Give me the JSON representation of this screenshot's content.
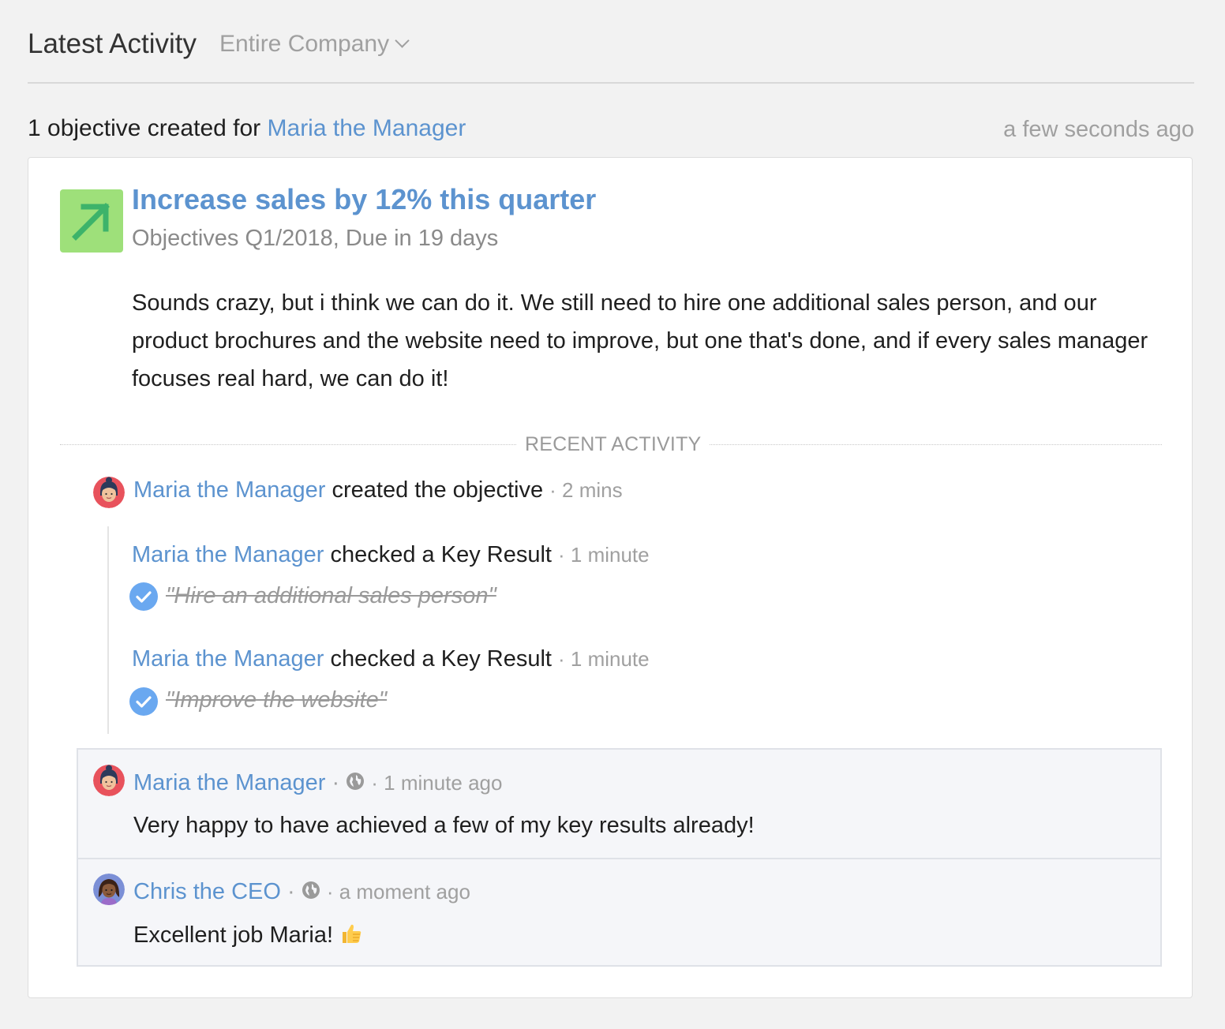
{
  "header": {
    "title": "Latest Activity",
    "scope_label": "Entire Company"
  },
  "activity": {
    "summary_prefix": "1 objective created for",
    "summary_user": "Maria the Manager",
    "timestamp": "a few seconds ago"
  },
  "objective": {
    "icon": "arrow-up-right-icon",
    "icon_color": "#9ee07a",
    "title": "Increase sales by 12% this quarter",
    "subtitle": "Objectives Q1/2018, Due in 19 days",
    "description": "Sounds crazy, but i think we can do it. We still need to hire one additional sales person, and our product brochures and the website need to improve, but one that's done, and if every sales manager focuses real hard, we can do it!"
  },
  "recent_activity": {
    "label": "RECENT ACTIVITY",
    "created": {
      "user": "Maria the Manager",
      "action": "created the objective",
      "time": "· 2 mins"
    },
    "checks": [
      {
        "user": "Maria the Manager",
        "action": "checked a Key Result",
        "time": "· 1 minute",
        "key_result": "\"Hire an additional sales person\""
      },
      {
        "user": "Maria the Manager",
        "action": "checked a Key Result",
        "time": "· 1 minute",
        "key_result": "\"Improve the website\""
      }
    ]
  },
  "comments": [
    {
      "user": "Maria the Manager",
      "sep": "·",
      "time": "· 1 minute ago",
      "text": "Very happy to have achieved a few of my key results already!"
    },
    {
      "user": "Chris the CEO",
      "sep": "·",
      "time": "· a moment ago",
      "text": "Excellent job Maria!"
    }
  ],
  "colors": {
    "link": "#5c93cf",
    "check": "#6aa8f0",
    "objective_icon": "#9ee07a"
  }
}
